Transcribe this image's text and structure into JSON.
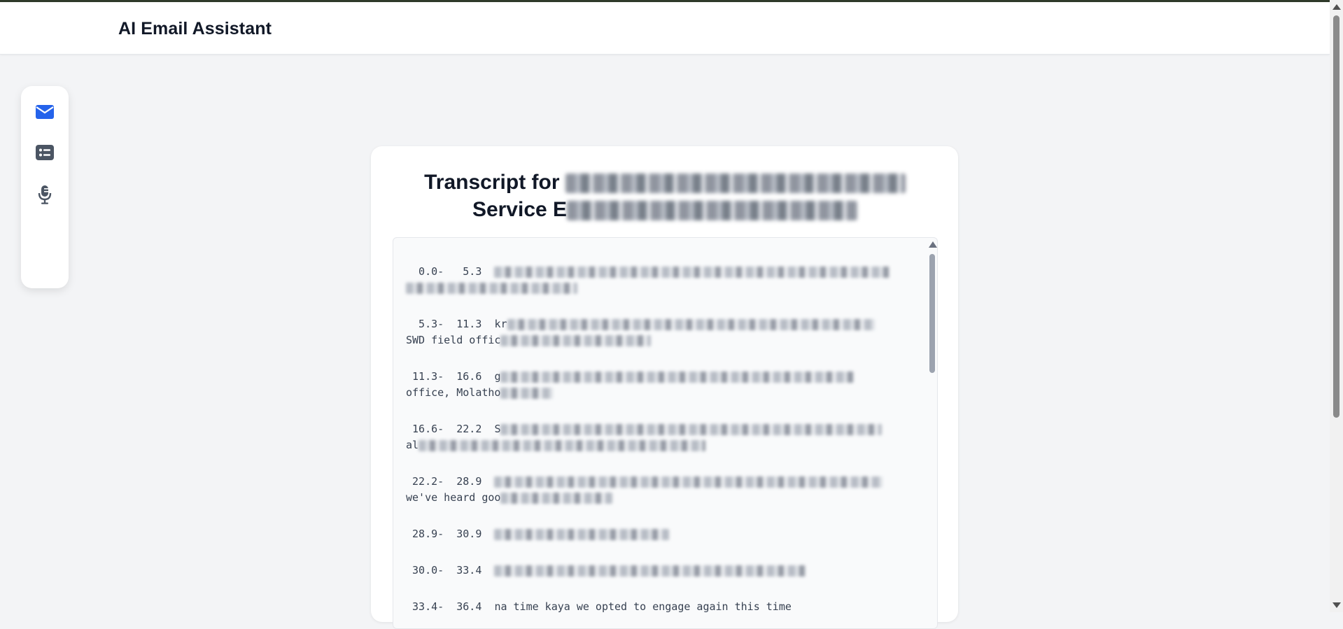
{
  "app": {
    "title": "AI Email Assistant"
  },
  "sidebar": {
    "items": [
      {
        "icon": "envelope-icon",
        "active": true
      },
      {
        "icon": "list-icon",
        "active": false
      },
      {
        "icon": "microphone-icon",
        "active": false
      }
    ]
  },
  "transcript": {
    "title_prefix": "Transcript for",
    "title_line2_prefix": "Service E",
    "segments": [
      {
        "timestamp": "  0.0-   5.3",
        "visible_text": "",
        "cont_text": ""
      },
      {
        "timestamp": "  5.3-  11.3",
        "visible_text": "kr",
        "cont_text": "SWD field offic"
      },
      {
        "timestamp": " 11.3-  16.6",
        "visible_text": "g",
        "cont_text": "office, Molatho"
      },
      {
        "timestamp": " 16.6-  22.2",
        "visible_text": "S",
        "cont_text": "al"
      },
      {
        "timestamp": " 22.2-  28.9",
        "visible_text": "",
        "cont_text": "we've heard goo"
      },
      {
        "timestamp": " 28.9-  30.9",
        "visible_text": "",
        "cont_text": ""
      },
      {
        "timestamp": " 30.0-  33.4",
        "visible_text": "",
        "cont_text": ""
      },
      {
        "timestamp": " 33.4-  36.4",
        "visible_text": "na time kaya we opted to engage again this time",
        "cont_text": ""
      }
    ]
  },
  "colors": {
    "accent": "#2563eb",
    "icon_muted": "#4b5563",
    "background": "#f3f4f6"
  }
}
